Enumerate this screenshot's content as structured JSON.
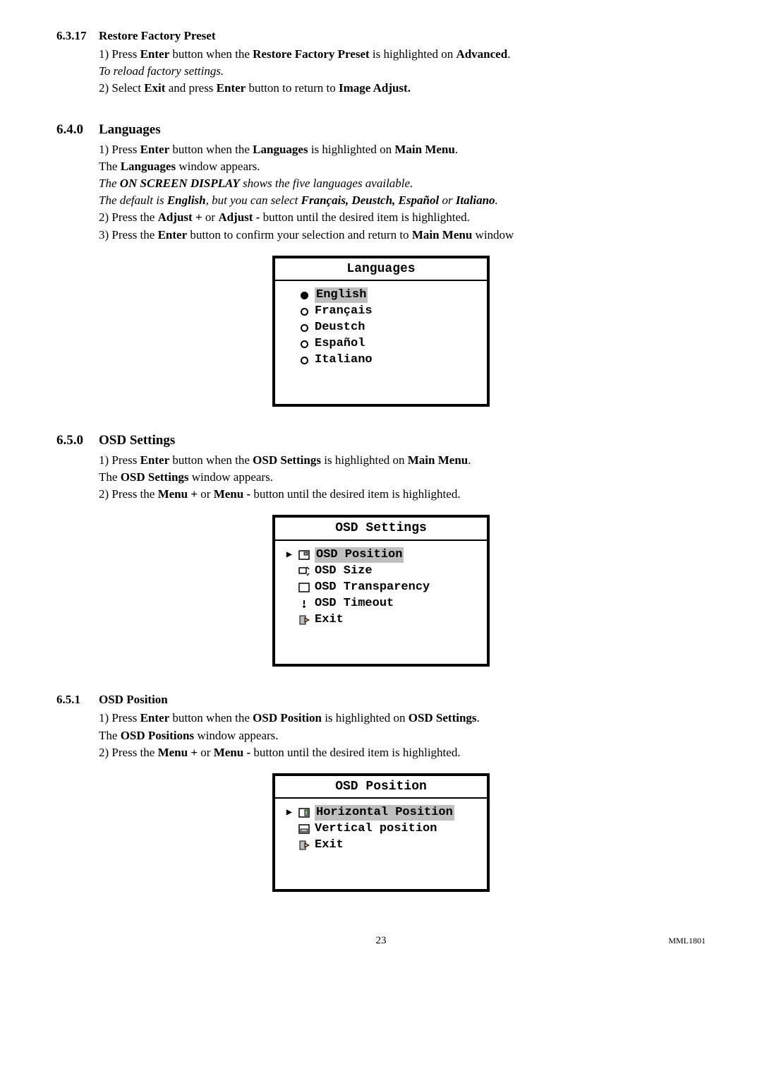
{
  "section_6317": {
    "num": "6.3.17",
    "title": "Restore Factory Preset",
    "lines": [
      {
        "parts": [
          "1) Press ",
          [
            "b",
            "Enter"
          ],
          " button when the ",
          [
            "b",
            "Restore Factory Preset"
          ],
          " is highlighted on ",
          [
            "b",
            "Advanced"
          ],
          "."
        ]
      },
      {
        "parts": [
          [
            "i",
            "To reload factory settings."
          ]
        ]
      },
      {
        "parts": [
          "2) Select ",
          [
            "b",
            "Exit"
          ],
          " and press ",
          [
            "b",
            "Enter"
          ],
          " button to return to ",
          [
            "b",
            "Image Adjust."
          ]
        ]
      }
    ]
  },
  "section_640": {
    "num": "6.4.0",
    "title": "Languages",
    "lines": [
      {
        "parts": [
          "1) Press ",
          [
            "b",
            "Enter"
          ],
          " button when the ",
          [
            "b",
            "Languages"
          ],
          " is highlighted on ",
          [
            "b",
            "Main Menu"
          ],
          "."
        ]
      },
      {
        "parts": [
          "The ",
          [
            "b",
            "Languages"
          ],
          " window appears."
        ]
      },
      {
        "parts": [
          [
            "i",
            "The "
          ],
          [
            "bi",
            "ON SCREEN DISPLAY"
          ],
          [
            "i",
            " shows the five languages available."
          ]
        ]
      },
      {
        "parts": [
          [
            "i",
            " The default is "
          ],
          [
            "bi",
            "English"
          ],
          [
            "i",
            ", but you can select "
          ],
          [
            "bi",
            "Français, Deustch, Español"
          ],
          [
            "i",
            " or "
          ],
          [
            "bi",
            "Italiano"
          ],
          [
            "i",
            "."
          ]
        ]
      },
      {
        "parts": [
          "2) Press the ",
          [
            "b",
            "Adjust +"
          ],
          " or ",
          [
            "b",
            "Adjust -"
          ],
          " button until the desired item is highlighted."
        ]
      },
      {
        "parts": [
          "3) Press the ",
          [
            "b",
            "Enter"
          ],
          " button to confirm your selection and return to ",
          [
            "b",
            "Main Menu"
          ],
          " window"
        ]
      }
    ],
    "panel": {
      "title": "Languages",
      "items": [
        {
          "icon": "radio-filled",
          "label": "English",
          "selected": true
        },
        {
          "icon": "radio-empty",
          "label": "Français"
        },
        {
          "icon": "radio-empty",
          "label": "Deustch"
        },
        {
          "icon": "radio-empty",
          "label": "Español"
        },
        {
          "icon": "radio-empty",
          "label": "Italiano"
        }
      ]
    }
  },
  "section_650": {
    "num": "6.5.0",
    "title": "OSD Settings",
    "lines": [
      {
        "parts": [
          "1) Press ",
          [
            "b",
            "Enter"
          ],
          " button when the ",
          [
            "b",
            "OSD Settings"
          ],
          " is highlighted on ",
          [
            "b",
            "Main Menu"
          ],
          "."
        ]
      },
      {
        "parts": [
          "The ",
          [
            "b",
            "OSD Settings"
          ],
          " window appears."
        ]
      },
      {
        "parts": [
          "2) Press the ",
          [
            "b",
            "Menu +"
          ],
          " or ",
          [
            "b",
            "Menu -"
          ],
          " button until the desired item is highlighted."
        ]
      }
    ],
    "panel": {
      "title": "OSD Settings",
      "items": [
        {
          "icon": "osd-position-icon",
          "label": "OSD Position",
          "selected": true
        },
        {
          "icon": "osd-size-icon",
          "label": "OSD Size"
        },
        {
          "icon": "osd-trans-icon",
          "label": "OSD Transparency"
        },
        {
          "icon": "osd-timeout-icon",
          "label": "OSD Timeout"
        },
        {
          "icon": "exit-icon",
          "label": "Exit"
        }
      ]
    }
  },
  "section_651": {
    "num": "6.5.1",
    "title": "OSD Position",
    "lines": [
      {
        "parts": [
          "1) Press ",
          [
            "b",
            "Enter"
          ],
          " button when the ",
          [
            "b",
            "OSD Position"
          ],
          " is highlighted on ",
          [
            "b",
            "OSD Settings"
          ],
          "."
        ]
      },
      {
        "parts": [
          "The ",
          [
            "b",
            "OSD Positions"
          ],
          " window appears."
        ]
      },
      {
        "parts": [
          "2) Press the ",
          [
            "b",
            "Menu +"
          ],
          " or ",
          [
            "b",
            "Menu -"
          ],
          " button until the desired item is highlighted."
        ]
      }
    ],
    "panel": {
      "title": "OSD Position",
      "items": [
        {
          "icon": "hpos-icon",
          "label": "Horizontal Position",
          "selected": true
        },
        {
          "icon": "vpos-icon",
          "label": "Vertical position"
        },
        {
          "icon": "exit-icon",
          "label": "Exit"
        }
      ]
    }
  },
  "footer": {
    "page_num": "23",
    "doc_code": "MML1801"
  }
}
